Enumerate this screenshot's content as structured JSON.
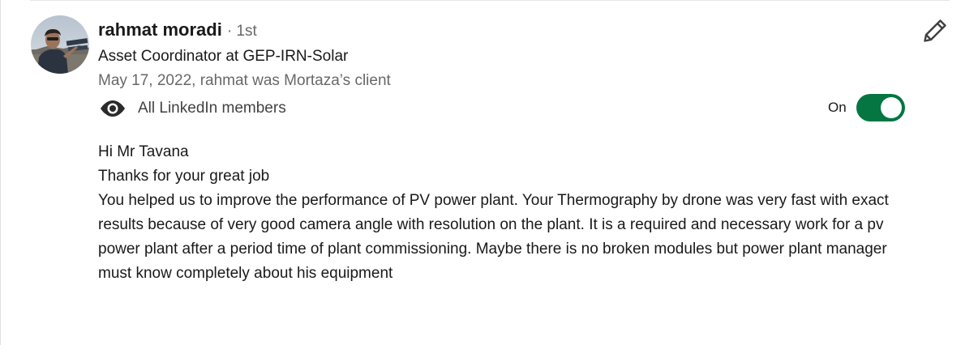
{
  "recommendation": {
    "recommender": {
      "name": "rahmat moradi",
      "degree": "· 1st",
      "headline": "Asset Coordinator at GEP-IRN-Solar",
      "meta": "May 17, 2022, rahmat was Mortaza’s client",
      "avatar_icon": "profile-photo"
    },
    "visibility": {
      "icon": "eye-icon",
      "label": "All LinkedIn members",
      "toggle_label": "On",
      "toggle_state": true,
      "toggle_color": "#057642"
    },
    "edit_icon": "pencil-icon",
    "text": {
      "line1": "Hi Mr Tavana",
      "line2": "Thanks for your great job",
      "paragraph": "You helped us to improve the performance of PV power plant. Your Thermography by drone was very fast with exact results because of very good camera angle with resolution on the plant. It is a required and necessary work for a pv power plant after a period time of plant commissioning. Maybe there is no broken modules but power plant manager must know completely about his equipment"
    }
  }
}
